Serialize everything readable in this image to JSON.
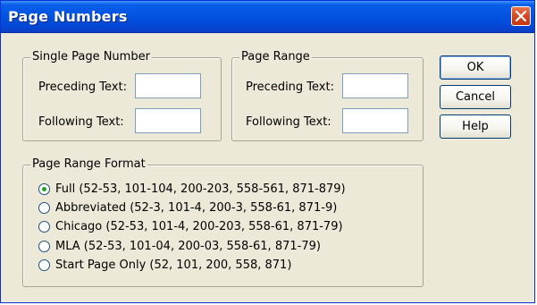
{
  "window": {
    "title": "Page Numbers"
  },
  "single_page_number": {
    "legend": "Single Page Number",
    "preceding_label": "Preceding Text:",
    "preceding_value": "",
    "following_label": "Following Text:",
    "following_value": ""
  },
  "page_range": {
    "legend": "Page Range",
    "preceding_label": "Preceding Text:",
    "preceding_value": "",
    "following_label": "Following Text:",
    "following_value": ""
  },
  "buttons": {
    "ok": "OK",
    "cancel": "Cancel",
    "help": "Help"
  },
  "page_range_format": {
    "legend": "Page Range Format",
    "selected_index": 0,
    "options": [
      "Full (52-53, 101-104, 200-203, 558-561, 871-879)",
      "Abbreviated (52-3, 101-4, 200-3, 558-61, 871-9)",
      "Chicago (52-53, 101-4, 200-203, 558-61, 871-79)",
      "MLA (52-53, 101-04, 200-03, 558-61, 871-79)",
      "Start Page Only (52, 101, 200, 558, 871)"
    ]
  },
  "colors": {
    "titlebar": "#0454e2",
    "dialog_bg": "#ece9d8",
    "close_button": "#d6431d",
    "radio_dot": "#21a121"
  },
  "icons": {
    "close": "close-icon"
  }
}
